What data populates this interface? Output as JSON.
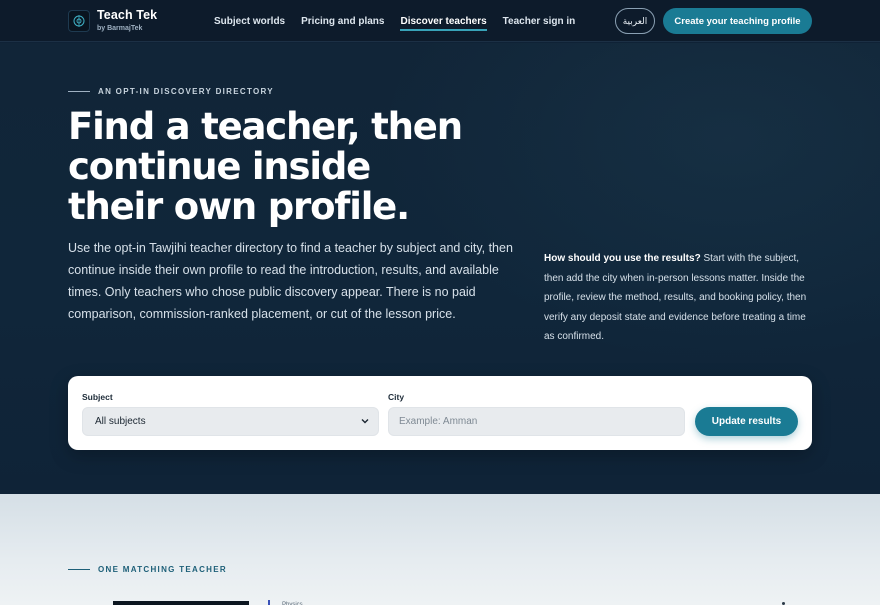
{
  "header": {
    "brand_name": "Teach Tek",
    "brand_sub": "by BarmajTek",
    "nav": [
      {
        "label": "Subject worlds",
        "active": false
      },
      {
        "label": "Pricing and plans",
        "active": false
      },
      {
        "label": "Discover teachers",
        "active": true
      },
      {
        "label": "Teacher sign in",
        "active": false
      }
    ],
    "language_toggle": "العربية",
    "cta_label": "Create your teaching profile"
  },
  "hero": {
    "eyebrow": "AN OPT-IN DISCOVERY DIRECTORY",
    "headline_lines": [
      "Find a teacher, then",
      "continue inside",
      "their own profile."
    ],
    "lede": "Use the opt-in Tawjihi teacher directory to find a teacher by subject and city, then continue inside their own profile to read the introduction, results, and available times. Only teachers who chose public discovery appear. There is no paid comparison, commission-ranked placement, or cut of the lesson price.",
    "aside_lead": "How should you use the results?",
    "aside_body": " Start with the subject, then add the city when in-person lessons matter. Inside the profile, review the method, results, and booking policy, then verify any deposit state and evidence before treating a time as confirmed."
  },
  "search": {
    "subject_label": "Subject",
    "subject_value": "All subjects",
    "city_label": "City",
    "city_value": "",
    "city_placeholder": "Example: Amman",
    "submit_label": "Update results"
  },
  "results": {
    "eyebrow": "ONE MATCHING TEACHER",
    "first_card_subject": "Physics"
  },
  "colors": {
    "accent": "#1a7b94",
    "hero_bg": "#10263a",
    "header_bg": "#0d1b2b"
  }
}
